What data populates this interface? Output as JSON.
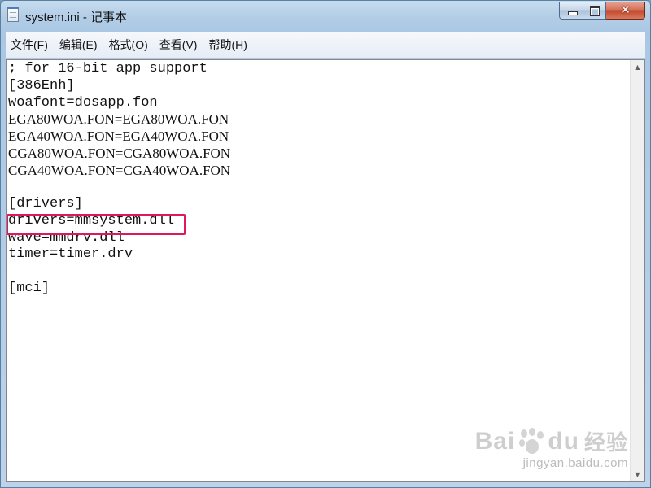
{
  "window": {
    "title": "system.ini - 记事本",
    "close_glyph": "✕"
  },
  "menu": {
    "items": [
      {
        "label": "文件(F)"
      },
      {
        "label": "编辑(E)"
      },
      {
        "label": "格式(O)"
      },
      {
        "label": "查看(V)"
      },
      {
        "label": "帮助(H)"
      }
    ]
  },
  "editor": {
    "lines": [
      "; for 16-bit app support",
      "[386Enh]",
      "woafont=dosapp.fon",
      "EGA80WOA.FON=EGA80WOA.FON",
      "EGA40WOA.FON=EGA40WOA.FON",
      "CGA80WOA.FON=CGA80WOA.FON",
      "CGA40WOA.FON=CGA40WOA.FON",
      "",
      "[drivers]",
      "drivers=mmsystem.dll",
      "wave=mmdrv.dll",
      "timer=timer.drv",
      "",
      "[mci]"
    ],
    "highlighted_line": "drivers=mmsystem.dll",
    "highlight_color": "#e0165e"
  },
  "scrollbar": {
    "up_icon": "▲",
    "down_icon": "▼"
  },
  "watermark": {
    "brand_left": "Bai",
    "brand_right": "du",
    "brand_cn": "经验",
    "url": "jingyan.baidu.com"
  },
  "colors": {
    "frame": "#b3cde6",
    "close_button": "#c2452a",
    "highlight": "#e0165e"
  }
}
